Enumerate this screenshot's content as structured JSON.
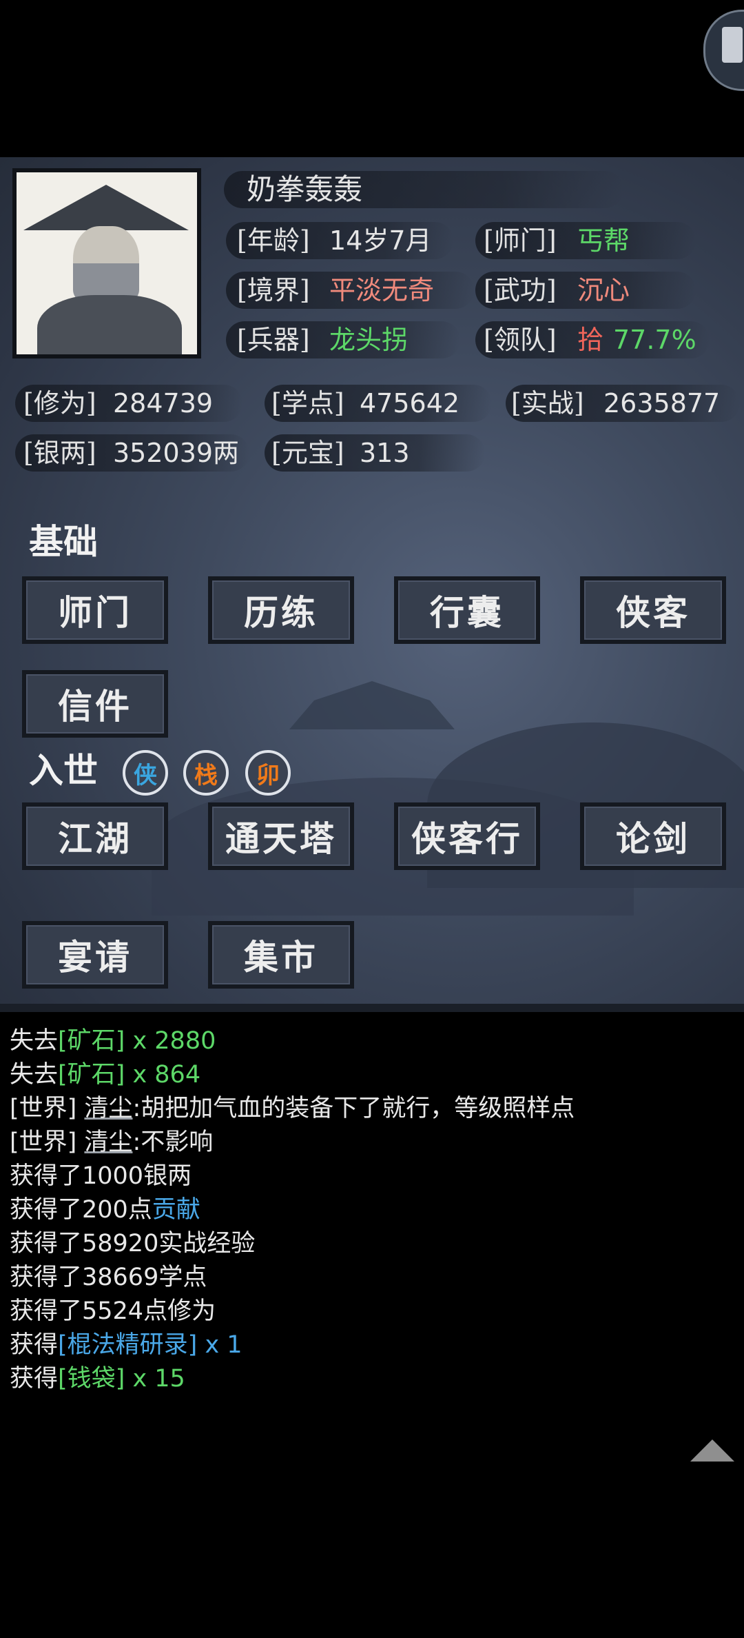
{
  "profile": {
    "name": "奶拳轰轰",
    "age_label": "[年龄]",
    "age_value": "14岁7月",
    "sect_label": "[师门]",
    "sect_value": "丐帮",
    "realm_label": "[境界]",
    "realm_value": "平淡无奇",
    "skill_label": "[武功]",
    "skill_value": "沉心",
    "weapon_label": "[兵器]",
    "weapon_value": "龙头拐",
    "lead_label": "[领队]",
    "lead_value_a": "拾",
    "lead_value_b": "77.7%"
  },
  "stats": {
    "cultivation_label": "[修为]",
    "cultivation_value": "284739",
    "study_label": "[学点]",
    "study_value": "475642",
    "combat_label": "[实战]",
    "combat_value": "2635877",
    "silver_label": "[银两]",
    "silver_value": "352039两",
    "ingot_label": "[元宝]",
    "ingot_value": "313"
  },
  "basics": {
    "title": "基础",
    "buttons": [
      "师门",
      "历练",
      "行囊",
      "侠客",
      "信件"
    ]
  },
  "world": {
    "title": "入世",
    "seals": [
      {
        "char": "侠",
        "color": "#3aa6e0"
      },
      {
        "char": "栈",
        "color": "#f07a1a"
      },
      {
        "char": "卯",
        "color": "#f07a1a"
      }
    ],
    "buttons": [
      "江湖",
      "通天塔",
      "侠客行",
      "论剑",
      "宴请",
      "集市"
    ]
  },
  "log": [
    {
      "a": "失去",
      "b": "[矿石]",
      "c": " x 2880"
    },
    {
      "a": "失去",
      "b": "[矿石]",
      "c": " x 864"
    },
    {
      "a": "[世界] ",
      "b": "清尘",
      "c": ":胡把加气血的装备下了就行，等级照样点"
    },
    {
      "a": "[世界] ",
      "b": "清尘",
      "c": ":不影响"
    },
    {
      "a": "获得了1000银两"
    },
    {
      "a": "获得了200点",
      "b": "贡献"
    },
    {
      "a": "获得了58920实战经验"
    },
    {
      "a": "获得了38669学点"
    },
    {
      "a": "获得了5524点修为"
    },
    {
      "a": "获得",
      "b": "[棍法精研录]",
      "c": " x 1"
    },
    {
      "a": "获得",
      "b": "[钱袋]",
      "c": " x 15"
    }
  ],
  "colors": {
    "green": "#5dd868",
    "red": "#f0655a",
    "blue": "#4aa8e8",
    "panel": "#3f4a5e"
  },
  "icons": {
    "scroll_up": "triangle-up-icon"
  }
}
